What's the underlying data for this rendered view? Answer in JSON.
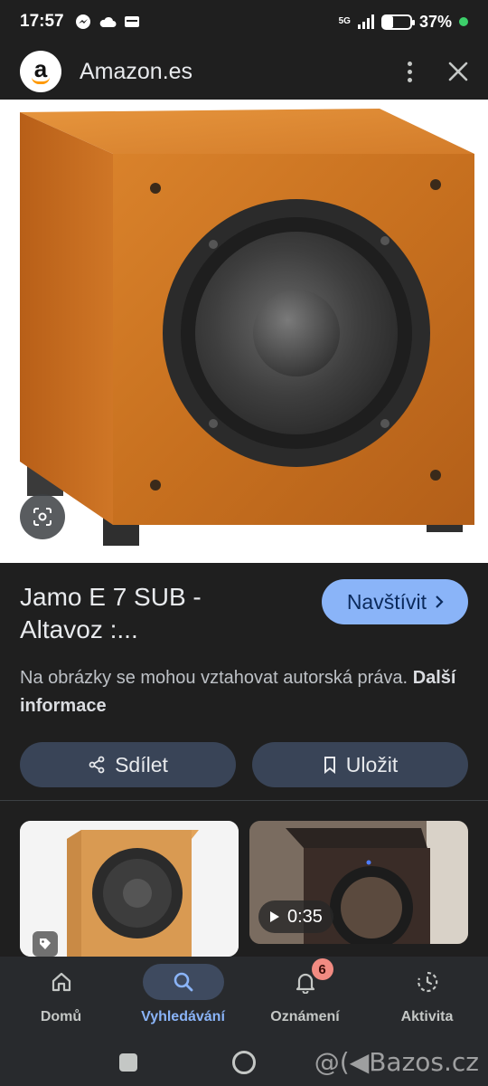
{
  "status_bar": {
    "time": "17:57",
    "network": "5G",
    "battery": "37%",
    "battery_level": 0.37,
    "icons": [
      "messenger-icon",
      "cloud-icon",
      "wallet-icon"
    ]
  },
  "app_bar": {
    "site_name": "Amazon.es",
    "logo_letter": "a"
  },
  "result": {
    "title": "Jamo E 7 SUB - Altavoz :...",
    "visit_label": "Navštívit",
    "copyright_text": "Na obrázky se mohou vztahovat autorská práva.",
    "more_info_label": "Další informace",
    "share_label": "Sdílet",
    "save_label": "Uložit"
  },
  "related": [
    {
      "kind": "image",
      "badge": "tag-icon"
    },
    {
      "kind": "video",
      "duration": "0:35"
    }
  ],
  "bottom_nav": {
    "items": [
      {
        "label": "Domů",
        "icon": "home-icon",
        "active": false
      },
      {
        "label": "Vyhledávání",
        "icon": "search-icon",
        "active": true
      },
      {
        "label": "Oznámení",
        "icon": "bell-icon",
        "active": false,
        "badge": "6"
      },
      {
        "label": "Aktivita",
        "icon": "activity-icon",
        "active": false
      }
    ]
  },
  "watermark": "@(◀Bazos.cz",
  "colors": {
    "background": "#1f1f1f",
    "accent": "#8ab4f8",
    "pill": "#394457",
    "nav_background": "#282a2d",
    "badge": "#f28b82"
  }
}
